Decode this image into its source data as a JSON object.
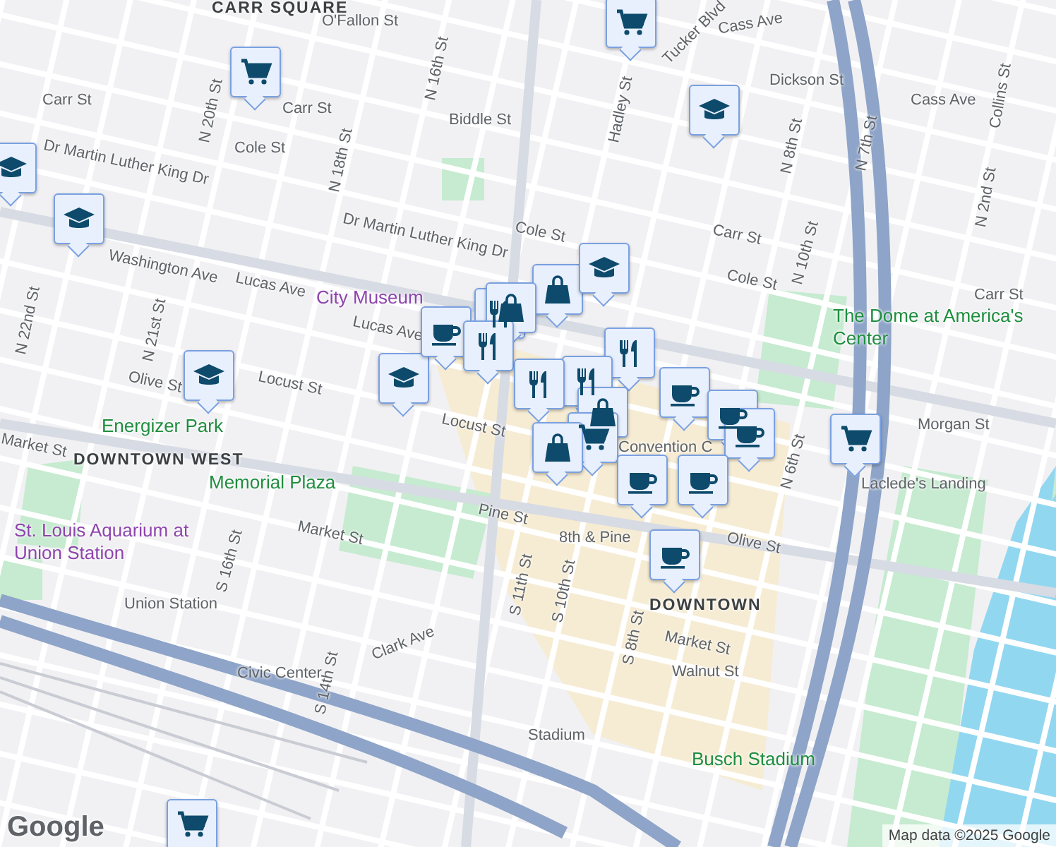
{
  "map": {
    "labels": [
      {
        "text": "CARR SQUARE",
        "kind": "area"
      },
      {
        "text": "O'Fallon St",
        "kind": "street"
      },
      {
        "text": "Cass Ave",
        "kind": "street"
      },
      {
        "text": "Carr St",
        "kind": "street"
      },
      {
        "text": "Carr St",
        "kind": "street"
      },
      {
        "text": "Biddle St",
        "kind": "street"
      },
      {
        "text": "Dickson St",
        "kind": "street"
      },
      {
        "text": "Cass Ave",
        "kind": "street"
      },
      {
        "text": "Cole St",
        "kind": "street"
      },
      {
        "text": "Dr Martin Luther King Dr",
        "kind": "street"
      },
      {
        "text": "Dr Martin Luther King Dr",
        "kind": "street"
      },
      {
        "text": "Cole St",
        "kind": "street"
      },
      {
        "text": "Carr St",
        "kind": "street"
      },
      {
        "text": "Cole St",
        "kind": "street"
      },
      {
        "text": "Carr St",
        "kind": "street"
      },
      {
        "text": "Washington Ave",
        "kind": "street"
      },
      {
        "text": "Lucas Ave",
        "kind": "street"
      },
      {
        "text": "City Museum",
        "kind": "poi"
      },
      {
        "text": "Lucas Ave",
        "kind": "street"
      },
      {
        "text": "Olive St",
        "kind": "street"
      },
      {
        "text": "Locust St",
        "kind": "street"
      },
      {
        "text": "Locust St",
        "kind": "street"
      },
      {
        "text": "Energizer Park",
        "kind": "park"
      },
      {
        "text": "DOWNTOWN WEST",
        "kind": "area"
      },
      {
        "text": "Memorial Plaza",
        "kind": "park"
      },
      {
        "text": "Market St",
        "kind": "street"
      },
      {
        "text": "Market St",
        "kind": "street"
      },
      {
        "text": "Pine St",
        "kind": "street"
      },
      {
        "text": "8th & Pine",
        "kind": "street"
      },
      {
        "text": "Olive St",
        "kind": "street"
      },
      {
        "text": "DOWNTOWN",
        "kind": "area"
      },
      {
        "text": "Market St",
        "kind": "street"
      },
      {
        "text": "Walnut St",
        "kind": "street"
      },
      {
        "text": "St. Louis Aquarium at Union Station",
        "kind": "poi"
      },
      {
        "text": "Union Station",
        "kind": "street"
      },
      {
        "text": "Clark Ave",
        "kind": "street"
      },
      {
        "text": "Civic Center",
        "kind": "street"
      },
      {
        "text": "Stadium",
        "kind": "street"
      },
      {
        "text": "Busch Stadium",
        "kind": "park"
      },
      {
        "text": "The Dome at America's Center",
        "kind": "park"
      },
      {
        "text": "Morgan St",
        "kind": "street"
      },
      {
        "text": "Laclede's Landing",
        "kind": "street"
      },
      {
        "text": "Convention C",
        "kind": "street"
      },
      {
        "text": "Tucker Blvd",
        "kind": "street"
      },
      {
        "text": "Hadley St",
        "kind": "street"
      },
      {
        "text": "N 10th St",
        "kind": "street"
      },
      {
        "text": "N 8th St",
        "kind": "street"
      },
      {
        "text": "N 7th St",
        "kind": "street"
      },
      {
        "text": "N 6th St",
        "kind": "street"
      },
      {
        "text": "Collins St",
        "kind": "street"
      },
      {
        "text": "N 2nd St",
        "kind": "street"
      },
      {
        "text": "N 16th St",
        "kind": "street"
      },
      {
        "text": "N 18th St",
        "kind": "street"
      },
      {
        "text": "N 20th St",
        "kind": "street"
      },
      {
        "text": "N 21st St",
        "kind": "street"
      },
      {
        "text": "N 22nd St",
        "kind": "street"
      },
      {
        "text": "S 16th St",
        "kind": "street"
      },
      {
        "text": "S 14th St",
        "kind": "street"
      },
      {
        "text": "S 11th St",
        "kind": "street"
      },
      {
        "text": "S 10th St",
        "kind": "street"
      },
      {
        "text": "S 8th St",
        "kind": "street"
      }
    ],
    "pins": [
      {
        "kind": "cart"
      },
      {
        "kind": "cart"
      },
      {
        "kind": "cap"
      },
      {
        "kind": "cap"
      },
      {
        "kind": "cap"
      },
      {
        "kind": "cap"
      },
      {
        "kind": "cap"
      },
      {
        "kind": "cart"
      },
      {
        "kind": "cart"
      },
      {
        "kind": "bag"
      },
      {
        "kind": "fork"
      },
      {
        "kind": "bag"
      },
      {
        "kind": "cup"
      },
      {
        "kind": "fork"
      },
      {
        "kind": "cap"
      },
      {
        "kind": "fork"
      },
      {
        "kind": "fork"
      },
      {
        "kind": "fork"
      },
      {
        "kind": "cup"
      },
      {
        "kind": "cup"
      },
      {
        "kind": "cup"
      },
      {
        "kind": "bag"
      },
      {
        "kind": "cart"
      },
      {
        "kind": "bag"
      },
      {
        "kind": "cup"
      },
      {
        "kind": "cup"
      },
      {
        "kind": "cup"
      }
    ],
    "logo": "Google",
    "attribution": "Map data ©2025 Google"
  }
}
